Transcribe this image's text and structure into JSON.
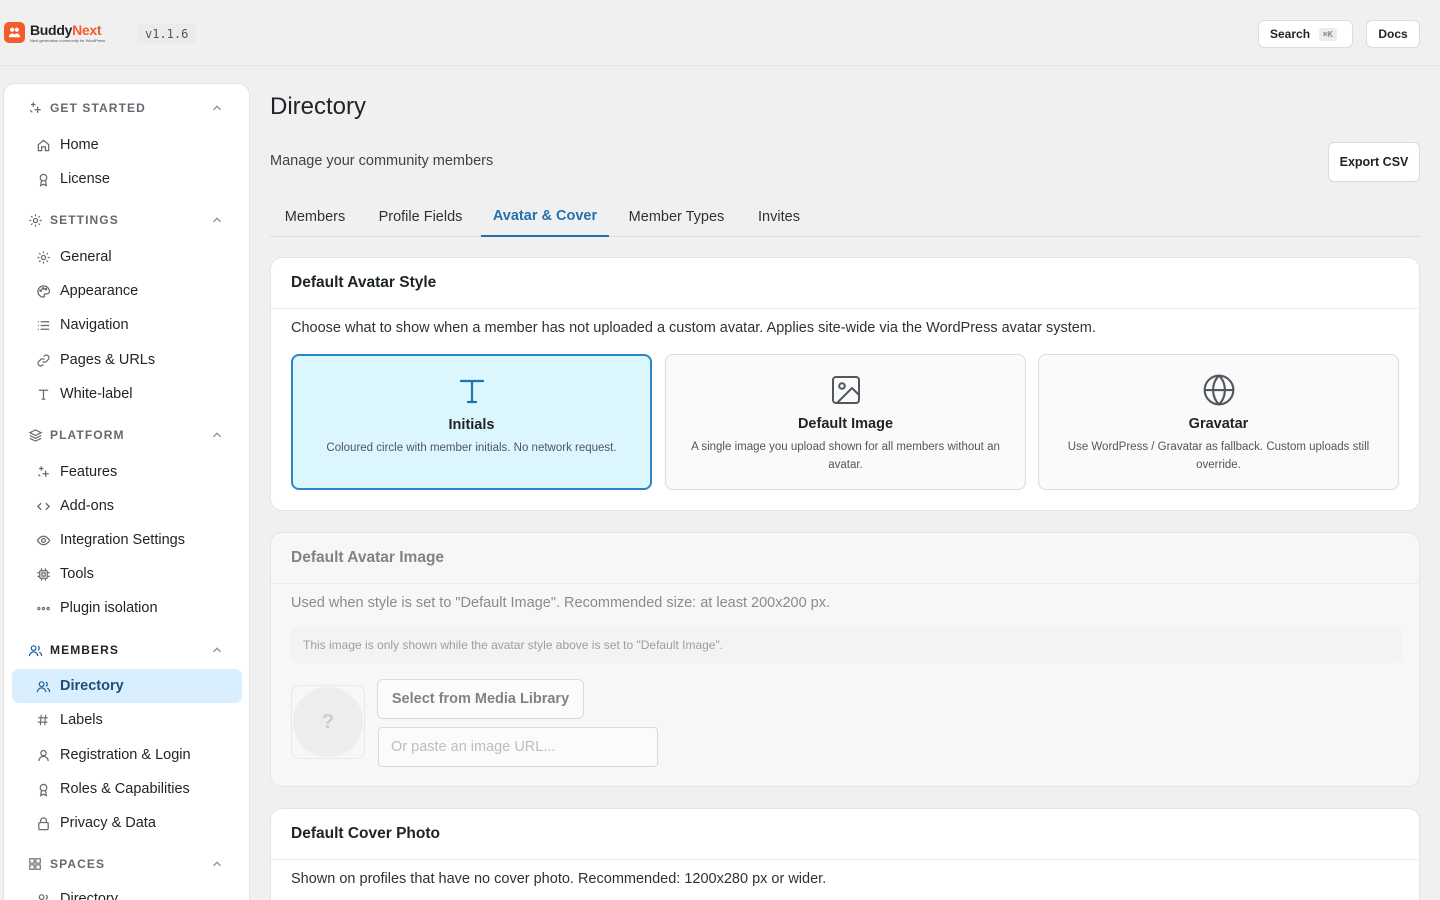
{
  "app": {
    "name_part1": "Buddy",
    "name_part2": "Next",
    "tagline": "Next generation community for WordPress",
    "version": "v1.1.6"
  },
  "topbar": {
    "search_label": "Search",
    "search_shortcut": "⌘K",
    "docs_label": "Docs"
  },
  "sidebar": {
    "sections": [
      {
        "title": "GET STARTED",
        "icon": "sparkle-icon",
        "items": [
          {
            "label": "Home",
            "icon": "home-icon"
          },
          {
            "label": "License",
            "icon": "award-icon"
          }
        ]
      },
      {
        "title": "SETTINGS",
        "icon": "gear-icon",
        "items": [
          {
            "label": "General",
            "icon": "gear-icon"
          },
          {
            "label": "Appearance",
            "icon": "palette-icon"
          },
          {
            "label": "Navigation",
            "icon": "list-icon"
          },
          {
            "label": "Pages & URLs",
            "icon": "link-icon"
          },
          {
            "label": "White-label",
            "icon": "type-icon"
          }
        ]
      },
      {
        "title": "PLATFORM",
        "icon": "layers-icon",
        "items": [
          {
            "label": "Features",
            "icon": "sparkle-icon"
          },
          {
            "label": "Add-ons",
            "icon": "code-icon"
          },
          {
            "label": "Integration Settings",
            "icon": "eye-icon"
          },
          {
            "label": "Tools",
            "icon": "cpu-icon"
          },
          {
            "label": "Plugin isolation",
            "icon": "dots-icon"
          }
        ]
      },
      {
        "title": "MEMBERS",
        "icon": "users-icon",
        "items": [
          {
            "label": "Directory",
            "icon": "users-icon",
            "active": true
          },
          {
            "label": "Labels",
            "icon": "hash-icon"
          },
          {
            "label": "Registration & Login",
            "icon": "user-icon"
          },
          {
            "label": "Roles & Capabilities",
            "icon": "award-icon"
          },
          {
            "label": "Privacy & Data",
            "icon": "lock-icon"
          }
        ]
      },
      {
        "title": "SPACES",
        "icon": "grid-icon",
        "items": [
          {
            "label": "Directory",
            "icon": "users-icon"
          }
        ]
      }
    ]
  },
  "page": {
    "title": "Directory",
    "subtitle": "Manage your community members",
    "export_label": "Export CSV",
    "tabs": [
      {
        "label": "Members"
      },
      {
        "label": "Profile Fields"
      },
      {
        "label": "Avatar & Cover",
        "active": true
      },
      {
        "label": "Member Types"
      },
      {
        "label": "Invites"
      }
    ]
  },
  "avatar_style": {
    "title": "Default Avatar Style",
    "description": "Choose what to show when a member has not uploaded a custom avatar. Applies site-wide via the WordPress avatar system.",
    "options": [
      {
        "title": "Initials",
        "description": "Coloured circle with member initials. No network request.",
        "icon": "type-icon",
        "selected": true
      },
      {
        "title": "Default Image",
        "description": "A single image you upload shown for all members without an avatar.",
        "icon": "image-icon"
      },
      {
        "title": "Gravatar",
        "description": "Use WordPress / Gravatar as fallback. Custom uploads still override.",
        "icon": "globe-icon"
      }
    ]
  },
  "avatar_image": {
    "title": "Default Avatar Image",
    "description": "Used when style is set to \"Default Image\". Recommended size: at least 200x200 px.",
    "notice": "This image is only shown while the avatar style above is set to \"Default Image\".",
    "preview_placeholder": "?",
    "media_button": "Select from Media Library",
    "url_placeholder": "Or paste an image URL..."
  },
  "cover_photo": {
    "title": "Default Cover Photo",
    "description": "Shown on profiles that have no cover photo. Recommended: 1200x280 px or wider."
  },
  "colors": {
    "brand": "#f25c2a",
    "accent": "#2271b1",
    "active_nav_bg": "#d9eefe",
    "selected_option_bg": "#dcf6fd"
  }
}
